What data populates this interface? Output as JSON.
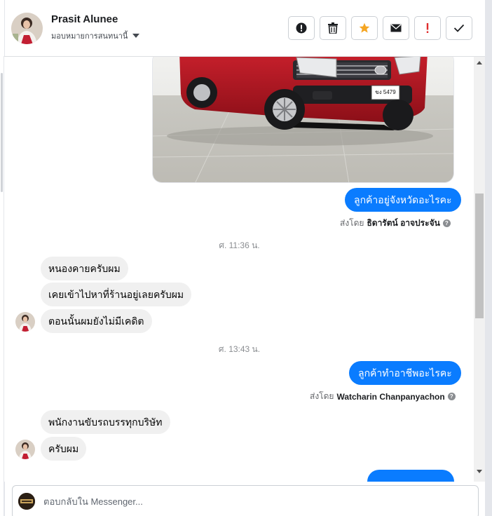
{
  "header": {
    "contact_name": "Prasit Alunee",
    "assign_label": "มอบหมายการสนทนานี้"
  },
  "actions": [
    {
      "name": "report-spam",
      "icon": "alert-circle-icon"
    },
    {
      "name": "delete",
      "icon": "trash-icon"
    },
    {
      "name": "star",
      "icon": "star-icon",
      "color": "#f5a623"
    },
    {
      "name": "mark-unread",
      "icon": "envelope-icon"
    },
    {
      "name": "follow-up",
      "icon": "exclamation-icon",
      "color": "#e02d2d"
    },
    {
      "name": "mark-done",
      "icon": "check-icon"
    }
  ],
  "messages": {
    "out_1": "ลูกค้าอยู่จังหวัดอะไรคะ",
    "sent_by_prefix_1": "ส่งโดย",
    "sent_by_name_1": "ธิดารัตน์ อาจประจัน",
    "time_1": "ศ. 11:36 น.",
    "in_1": "หนองคายครับผม",
    "in_2": "เคยเข้าไปหาที่ร้านอยู่เลยครับผม",
    "in_3": "ตอนนั้นผมยังไม่มีเคดิต",
    "time_2": "ศ. 13:43 น.",
    "out_2": "ลูกค้าทำอาชีพอะไรคะ",
    "sent_by_prefix_2": "ส่งโดย",
    "sent_by_name_2": "Watcharin Chanpanyachon",
    "in_4": "พนักงานขับรถบรรทุกบริษัท",
    "in_5": "ครับผม"
  },
  "photo": {
    "plate_text": "ขง 5479"
  },
  "composer": {
    "placeholder": "ตอบกลับใน Messenger..."
  },
  "colors": {
    "accent": "#0a7cff",
    "incoming_bubble": "#f0f0f0",
    "car_red": "#b3141f"
  }
}
